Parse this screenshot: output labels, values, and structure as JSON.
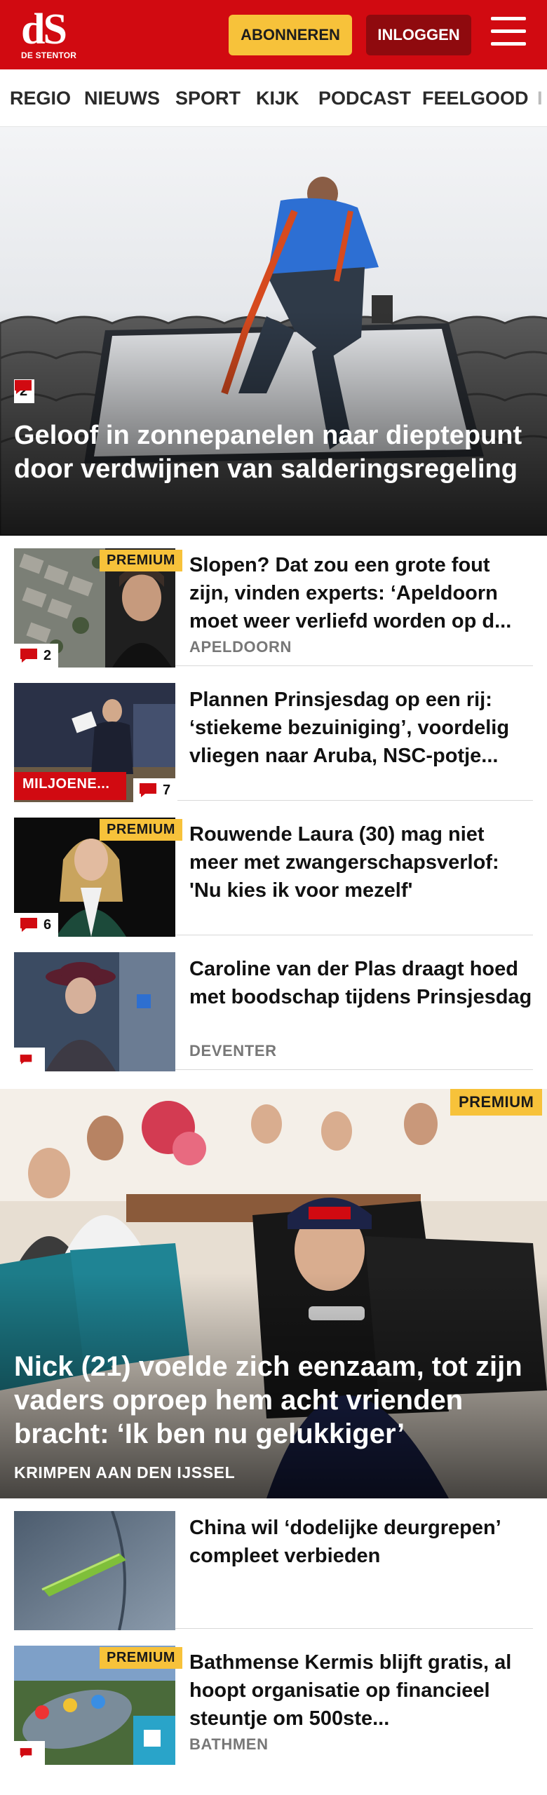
{
  "header": {
    "logo_mark": "dS",
    "logo_sub": "DE STENTOR",
    "subscribe_label": "ABONNEREN",
    "login_label": "INLOGGEN"
  },
  "nav": {
    "items": [
      {
        "label": "REGIO"
      },
      {
        "label": "NIEUWS"
      },
      {
        "label": "SPORT"
      },
      {
        "label": "KIJK"
      },
      {
        "label": "PODCAST"
      },
      {
        "label": "FEELGOOD"
      },
      {
        "label": "I"
      }
    ]
  },
  "hero": {
    "comments": "2",
    "title": "Geloof in zonnepanelen naar dieptepunt door verdwijnen van salderingsregeling"
  },
  "articles": [
    {
      "title": "Slopen? Dat zou een grote fout zijn, vinden experts: ‘Apeldoorn moet weer verliefd worden op d...",
      "location": "APELDOORN",
      "badge": "PREMIUM",
      "comments": "2"
    },
    {
      "title": "Plannen Prinsjesdag op een rij: ‘stiekeme bezuiniging’, voordelig vliegen naar Aruba, NSC-potje...",
      "tag": "MILJOENE...",
      "comments": "7"
    },
    {
      "title": "Rouwende Laura (30) mag niet meer met zwangerschapsverlof: 'Nu kies ik voor mezelf'",
      "badge": "PREMIUM",
      "comments": "6"
    },
    {
      "title": "Caroline van der Plas draagt hoed met boodschap tijdens Prinsjesdag",
      "location": "DEVENTER"
    },
    {
      "title": "China wil ‘dodelijke deurgrepen’ compleet verbieden"
    },
    {
      "title": "Bathmense Kermis blijft gratis, al hoopt organisatie op financieel steuntje om 500ste...",
      "location": "BATHMEN",
      "badge": "PREMIUM"
    }
  ],
  "feature": {
    "badge": "PREMIUM",
    "title": "Nick (21) voelde zich eenzaam, tot zijn vaders oproep hem acht vrienden bracht: ‘Ik ben nu gelukkiger’",
    "location": "KRIMPEN AAN DEN IJSSEL"
  },
  "colors": {
    "brand_red": "#d10a11",
    "login_dark_red": "#8f0a0e",
    "premium_yellow": "#f7c23a"
  }
}
